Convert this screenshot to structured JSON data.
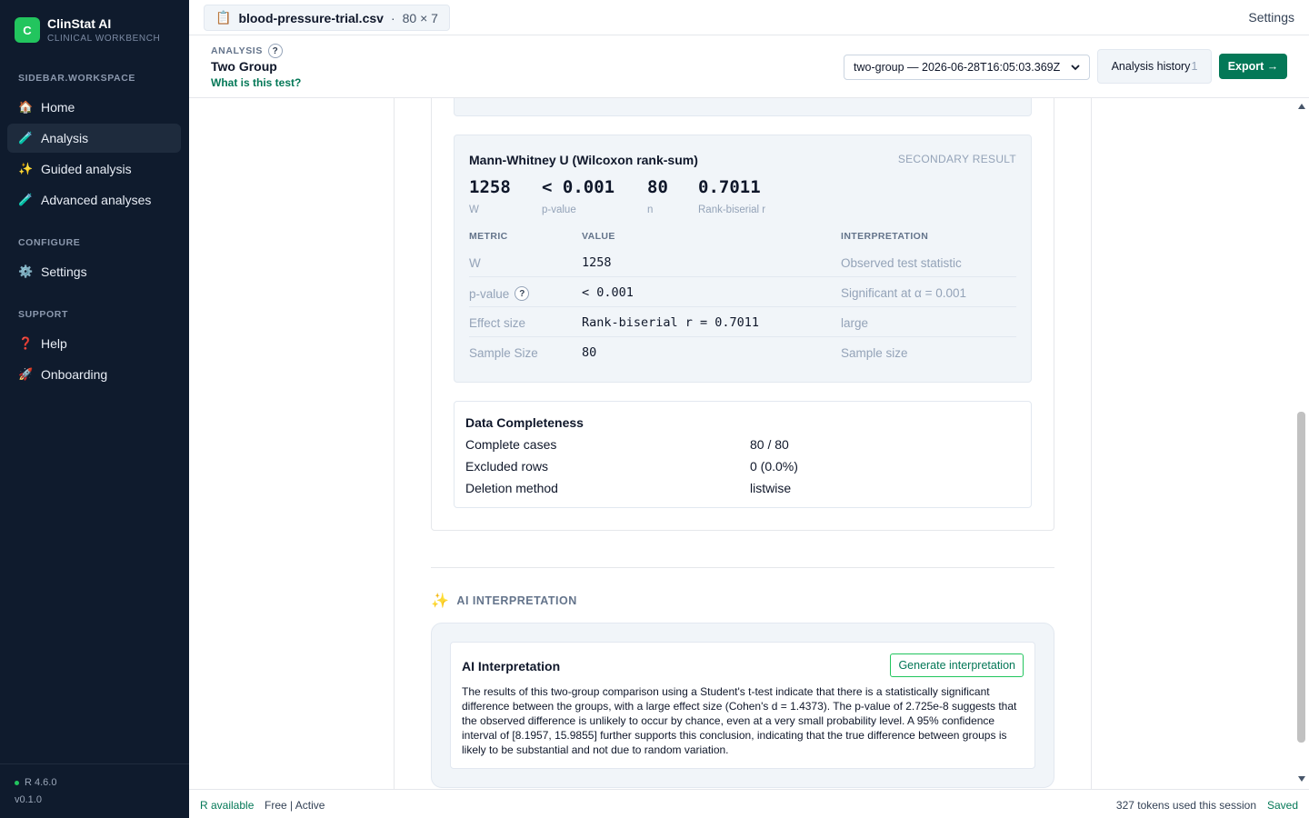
{
  "app": {
    "logo_letter": "C",
    "name": "ClinStat AI",
    "subtitle": "CLINICAL WORKBENCH"
  },
  "sidebar": {
    "sections": [
      {
        "title": "SIDEBAR.WORKSPACE"
      },
      {
        "title": "CONFIGURE"
      },
      {
        "title": "SUPPORT"
      }
    ],
    "items": [
      {
        "label": "Home",
        "icon": "🏠"
      },
      {
        "label": "Analysis",
        "icon": "🧪"
      },
      {
        "label": "Guided analysis",
        "icon": "✨"
      },
      {
        "label": "Advanced analyses",
        "icon": "🧪"
      },
      {
        "label": "Settings",
        "icon": "⚙️"
      },
      {
        "label": "Help",
        "icon": "❓"
      },
      {
        "label": "Onboarding",
        "icon": "🚀"
      }
    ],
    "r_version": "R 4.6.0",
    "app_version": "v0.1.0"
  },
  "topbar": {
    "file_icon": "📋",
    "file_name": "blood-pressure-trial.csv",
    "file_sep": "·",
    "file_dims": "80 × 7",
    "settings_label": "Settings"
  },
  "analysis_header": {
    "section_label": "ANALYSIS",
    "help_glyph": "?",
    "title": "Two Group",
    "what_is_link": "What is this test?",
    "run_select_value": "two-group — 2026-06-28T16:05:03.369Z",
    "history_label": "Analysis history",
    "history_count": "1",
    "export_label": "Export →"
  },
  "secondary_result": {
    "title": "Mann-Whitney U (Wilcoxon rank-sum)",
    "tag": "SECONDARY RESULT",
    "stats": [
      {
        "value": "1258",
        "label": "W"
      },
      {
        "value": "< 0.001",
        "label": "p-value"
      },
      {
        "value": "80",
        "label": "n"
      },
      {
        "value": "0.7011",
        "label": "Rank-biserial r"
      }
    ],
    "columns": [
      "METRIC",
      "VALUE",
      "INTERPRETATION"
    ],
    "rows": [
      {
        "metric": "W",
        "value": "1258",
        "interpretation": "Observed test statistic"
      },
      {
        "metric": "p-value",
        "value": "< 0.001",
        "interpretation": "Significant at α = 0.001"
      },
      {
        "metric": "Effect size",
        "value": "Rank-biserial r = 0.7011",
        "interpretation": "large"
      },
      {
        "metric": "Sample Size",
        "value": "80",
        "interpretation": "Sample size"
      }
    ]
  },
  "completeness": {
    "title": "Data Completeness",
    "rows": [
      {
        "label": "Complete cases",
        "value": "80 / 80"
      },
      {
        "label": "Excluded rows",
        "value": "0 (0.0%)"
      },
      {
        "label": "Deletion method",
        "value": "listwise"
      }
    ]
  },
  "ai": {
    "section_icon": "✨",
    "section_label": "AI INTERPRETATION",
    "card_title": "AI Interpretation",
    "generate_label": "Generate interpretation",
    "text": "The results of this two-group comparison using a Student's t-test indicate that there is a statistically significant difference between the groups, with a large effect size (Cohen's d = 1.4373). The p-value of 2.725e-8 suggests that the observed difference is unlikely to occur by chance, even at a very small probability level. A 95% confidence interval of [8.1957, 15.9855] further supports this conclusion, indicating that the true difference between groups is likely to be substantial and not due to random variation."
  },
  "statusbar": {
    "r_status": "R available",
    "plan": "Free | Active",
    "tokens": "327 tokens used this session",
    "saved": "Saved"
  },
  "colors": {
    "accent": "#047857",
    "sidebar_bg": "#0f1b2d",
    "logo": "#22c55e"
  }
}
